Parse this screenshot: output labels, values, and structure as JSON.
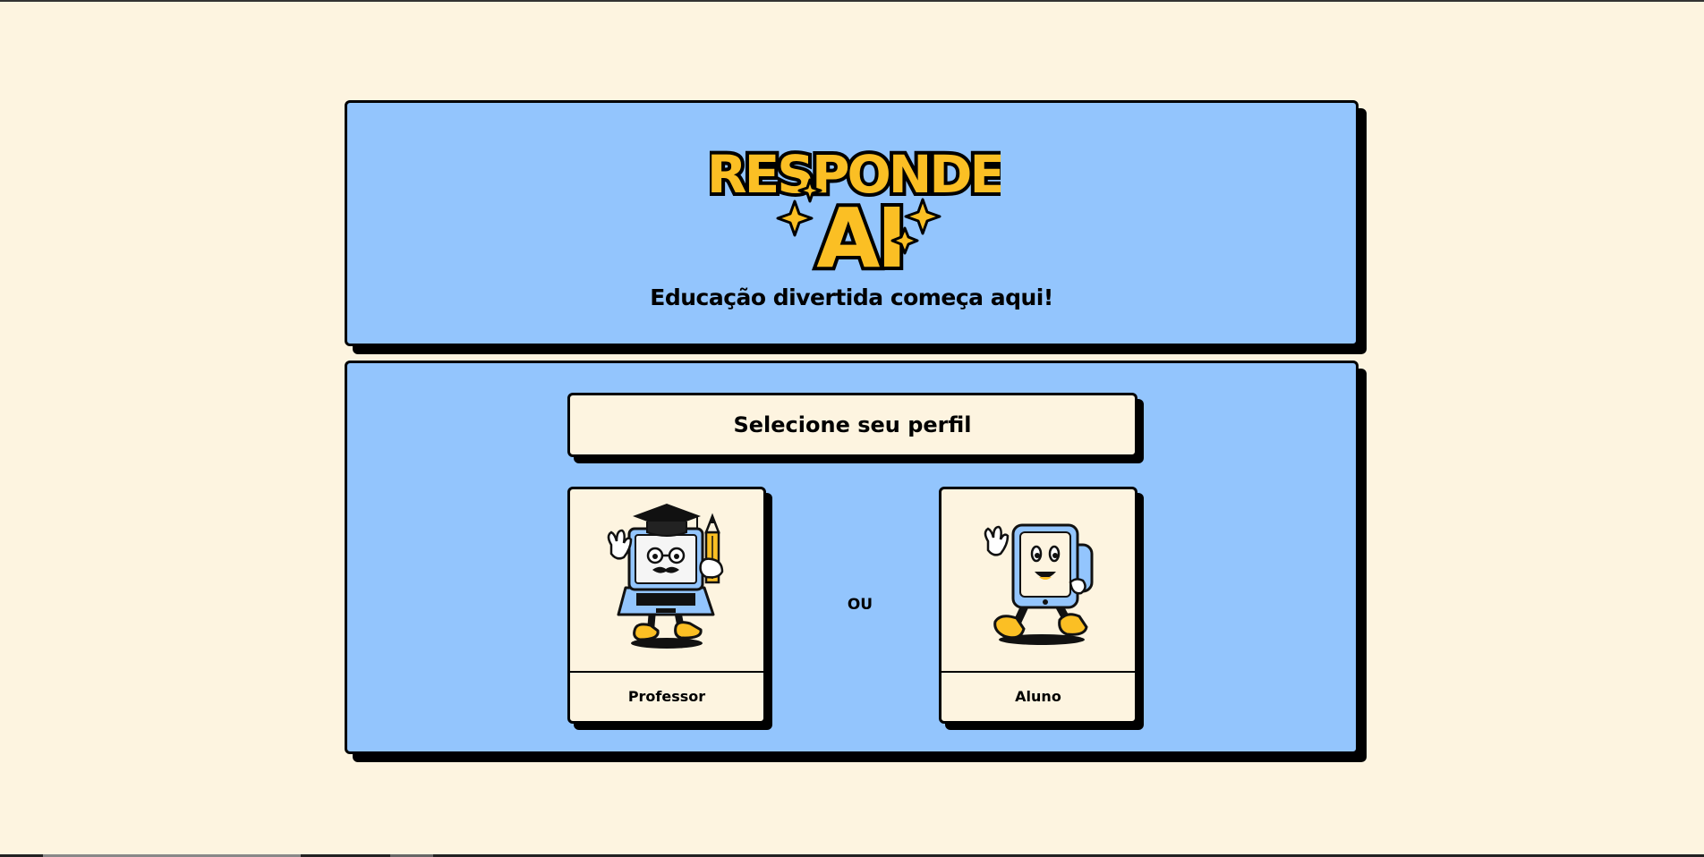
{
  "header": {
    "logo_line1": "RESPONDE",
    "logo_line2": "AI",
    "tagline": "Educação divertida começa aqui!"
  },
  "profile": {
    "title": "Selecione seu perfil",
    "separator": "OU",
    "options": [
      {
        "label": "Professor",
        "icon": "laptop-teacher-mascot-icon"
      },
      {
        "label": "Aluno",
        "icon": "tablet-student-mascot-icon"
      }
    ]
  },
  "colors": {
    "background": "#fdf4e0",
    "panel": "#93c5fd",
    "accent_yellow": "#fbbf24",
    "border": "#000000"
  }
}
